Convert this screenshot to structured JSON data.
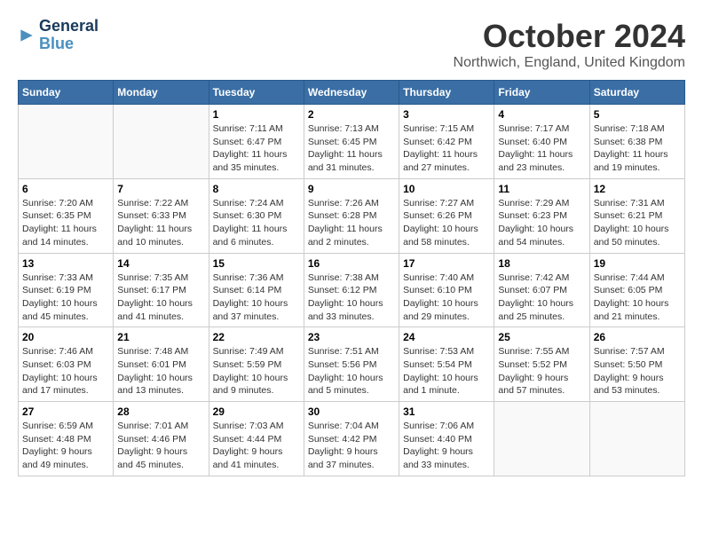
{
  "logo": {
    "line1": "General",
    "line2": "Blue",
    "arrow": "▶"
  },
  "title": "October 2024",
  "location": "Northwich, England, United Kingdom",
  "days_of_week": [
    "Sunday",
    "Monday",
    "Tuesday",
    "Wednesday",
    "Thursday",
    "Friday",
    "Saturday"
  ],
  "weeks": [
    [
      {
        "day": "",
        "empty": true
      },
      {
        "day": "",
        "empty": true
      },
      {
        "day": "1",
        "info": "Sunrise: 7:11 AM\nSunset: 6:47 PM\nDaylight: 11 hours\nand 35 minutes."
      },
      {
        "day": "2",
        "info": "Sunrise: 7:13 AM\nSunset: 6:45 PM\nDaylight: 11 hours\nand 31 minutes."
      },
      {
        "day": "3",
        "info": "Sunrise: 7:15 AM\nSunset: 6:42 PM\nDaylight: 11 hours\nand 27 minutes."
      },
      {
        "day": "4",
        "info": "Sunrise: 7:17 AM\nSunset: 6:40 PM\nDaylight: 11 hours\nand 23 minutes."
      },
      {
        "day": "5",
        "info": "Sunrise: 7:18 AM\nSunset: 6:38 PM\nDaylight: 11 hours\nand 19 minutes."
      }
    ],
    [
      {
        "day": "6",
        "info": "Sunrise: 7:20 AM\nSunset: 6:35 PM\nDaylight: 11 hours\nand 14 minutes."
      },
      {
        "day": "7",
        "info": "Sunrise: 7:22 AM\nSunset: 6:33 PM\nDaylight: 11 hours\nand 10 minutes."
      },
      {
        "day": "8",
        "info": "Sunrise: 7:24 AM\nSunset: 6:30 PM\nDaylight: 11 hours\nand 6 minutes."
      },
      {
        "day": "9",
        "info": "Sunrise: 7:26 AM\nSunset: 6:28 PM\nDaylight: 11 hours\nand 2 minutes."
      },
      {
        "day": "10",
        "info": "Sunrise: 7:27 AM\nSunset: 6:26 PM\nDaylight: 10 hours\nand 58 minutes."
      },
      {
        "day": "11",
        "info": "Sunrise: 7:29 AM\nSunset: 6:23 PM\nDaylight: 10 hours\nand 54 minutes."
      },
      {
        "day": "12",
        "info": "Sunrise: 7:31 AM\nSunset: 6:21 PM\nDaylight: 10 hours\nand 50 minutes."
      }
    ],
    [
      {
        "day": "13",
        "info": "Sunrise: 7:33 AM\nSunset: 6:19 PM\nDaylight: 10 hours\nand 45 minutes."
      },
      {
        "day": "14",
        "info": "Sunrise: 7:35 AM\nSunset: 6:17 PM\nDaylight: 10 hours\nand 41 minutes."
      },
      {
        "day": "15",
        "info": "Sunrise: 7:36 AM\nSunset: 6:14 PM\nDaylight: 10 hours\nand 37 minutes."
      },
      {
        "day": "16",
        "info": "Sunrise: 7:38 AM\nSunset: 6:12 PM\nDaylight: 10 hours\nand 33 minutes."
      },
      {
        "day": "17",
        "info": "Sunrise: 7:40 AM\nSunset: 6:10 PM\nDaylight: 10 hours\nand 29 minutes."
      },
      {
        "day": "18",
        "info": "Sunrise: 7:42 AM\nSunset: 6:07 PM\nDaylight: 10 hours\nand 25 minutes."
      },
      {
        "day": "19",
        "info": "Sunrise: 7:44 AM\nSunset: 6:05 PM\nDaylight: 10 hours\nand 21 minutes."
      }
    ],
    [
      {
        "day": "20",
        "info": "Sunrise: 7:46 AM\nSunset: 6:03 PM\nDaylight: 10 hours\nand 17 minutes."
      },
      {
        "day": "21",
        "info": "Sunrise: 7:48 AM\nSunset: 6:01 PM\nDaylight: 10 hours\nand 13 minutes."
      },
      {
        "day": "22",
        "info": "Sunrise: 7:49 AM\nSunset: 5:59 PM\nDaylight: 10 hours\nand 9 minutes."
      },
      {
        "day": "23",
        "info": "Sunrise: 7:51 AM\nSunset: 5:56 PM\nDaylight: 10 hours\nand 5 minutes."
      },
      {
        "day": "24",
        "info": "Sunrise: 7:53 AM\nSunset: 5:54 PM\nDaylight: 10 hours\nand 1 minute."
      },
      {
        "day": "25",
        "info": "Sunrise: 7:55 AM\nSunset: 5:52 PM\nDaylight: 9 hours\nand 57 minutes."
      },
      {
        "day": "26",
        "info": "Sunrise: 7:57 AM\nSunset: 5:50 PM\nDaylight: 9 hours\nand 53 minutes."
      }
    ],
    [
      {
        "day": "27",
        "info": "Sunrise: 6:59 AM\nSunset: 4:48 PM\nDaylight: 9 hours\nand 49 minutes."
      },
      {
        "day": "28",
        "info": "Sunrise: 7:01 AM\nSunset: 4:46 PM\nDaylight: 9 hours\nand 45 minutes."
      },
      {
        "day": "29",
        "info": "Sunrise: 7:03 AM\nSunset: 4:44 PM\nDaylight: 9 hours\nand 41 minutes."
      },
      {
        "day": "30",
        "info": "Sunrise: 7:04 AM\nSunset: 4:42 PM\nDaylight: 9 hours\nand 37 minutes."
      },
      {
        "day": "31",
        "info": "Sunrise: 7:06 AM\nSunset: 4:40 PM\nDaylight: 9 hours\nand 33 minutes."
      },
      {
        "day": "",
        "empty": true
      },
      {
        "day": "",
        "empty": true
      }
    ]
  ]
}
